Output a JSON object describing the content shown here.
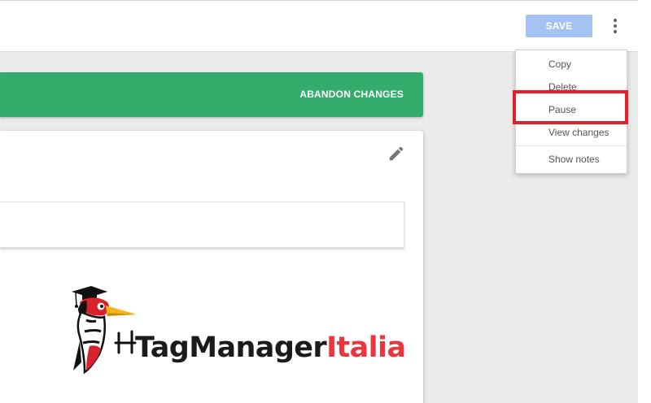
{
  "toolbar": {
    "save_label": "SAVE",
    "more_icon": "more-vert-icon"
  },
  "banner": {
    "abandon_label": "ABANDON CHANGES",
    "color": "#33ac6c"
  },
  "card": {
    "edit_icon": "pencil-icon"
  },
  "menu": {
    "items": [
      {
        "label": "Copy"
      },
      {
        "label": "Delete"
      },
      {
        "label": "Pause"
      },
      {
        "label": "View changes"
      },
      {
        "label": "Show notes"
      }
    ]
  },
  "annotation": {
    "highlighted_item": "Pause",
    "color": "#e3202a"
  },
  "logo": {
    "text_dark": "TagManager",
    "text_red": "Italia",
    "dark_color": "#1b1b1b",
    "red_color": "#e8363b"
  }
}
